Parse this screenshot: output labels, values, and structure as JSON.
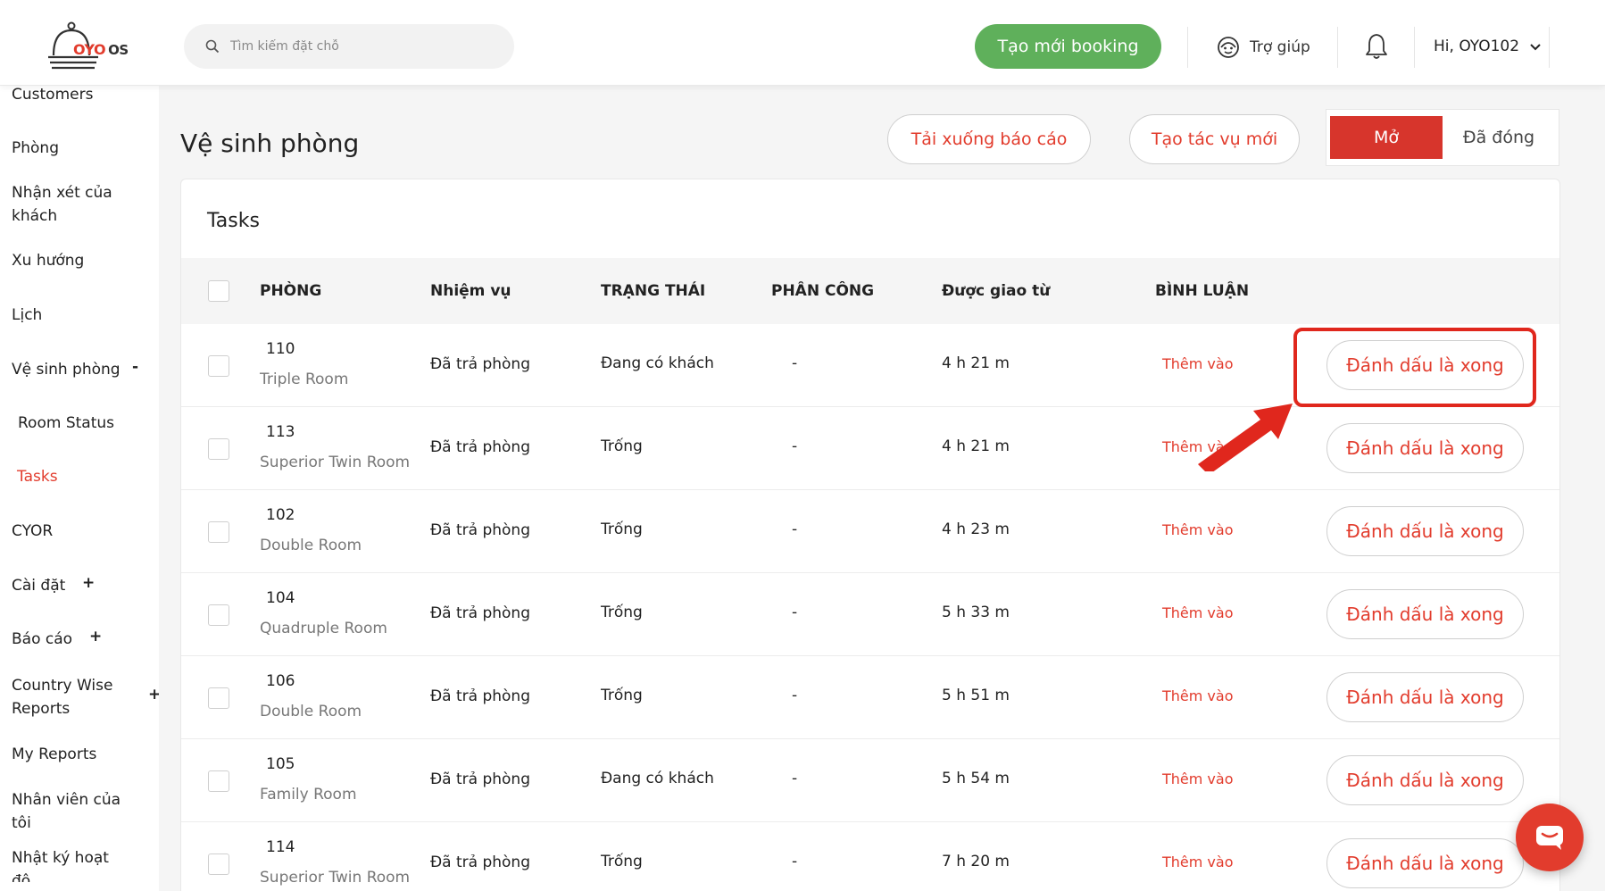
{
  "header": {
    "logo_text": "OYO",
    "logo_suffix": "OS",
    "search_placeholder": "Tìm kiếm đặt chỗ",
    "new_booking_label": "Tạo mới booking",
    "help_label": "Trợ giúp",
    "user_label": "Hi, OYO102"
  },
  "sidebar": {
    "items": [
      {
        "label": "Customers"
      },
      {
        "label": "Phòng"
      },
      {
        "label": "Nhận xét của"
      },
      {
        "label": "khách"
      },
      {
        "label": "Xu hướng"
      },
      {
        "label": "Lịch"
      },
      {
        "label": "Vệ sinh phòng",
        "sign": "-"
      },
      {
        "label": "Room Status"
      },
      {
        "label": "Tasks"
      },
      {
        "label": "CYOR"
      },
      {
        "label": "Cài đặt",
        "sign": "+"
      },
      {
        "label": "Báo cáo",
        "sign": "+"
      },
      {
        "label": "Country Wise"
      },
      {
        "label": "Reports",
        "sign": "+"
      },
      {
        "label": "My Reports"
      },
      {
        "label": "Nhân viên của"
      },
      {
        "label": "tôi"
      },
      {
        "label": "Nhật ký hoạt"
      },
      {
        "label": "đô"
      }
    ]
  },
  "page": {
    "title": "Vệ sinh phòng",
    "download_report_label": "Tải xuống báo cáo",
    "create_task_label": "Tạo tác vụ mới",
    "toggle_open_label": "Mở",
    "toggle_closed_label": "Đã đóng"
  },
  "table": {
    "card_title": "Tasks",
    "headers": [
      "PHÒNG",
      "Nhiệm vụ",
      "TRẠNG THÁI",
      "PHÂN CÔNG",
      "Được giao từ",
      "BÌNH LUẬN"
    ],
    "rows": [
      {
        "room": "110",
        "type": "Triple Room",
        "task": "Đã trả phòng",
        "status": "Đang có khách",
        "assign": "-",
        "since": "4 h 21 m",
        "comment": "Thêm vào",
        "action": "Đánh dấu là xong"
      },
      {
        "room": "113",
        "type": "Superior Twin Room",
        "task": "Đã trả phòng",
        "status": "Trống",
        "assign": "-",
        "since": "4 h 21 m",
        "comment": "Thêm vào",
        "action": "Đánh dấu là xong"
      },
      {
        "room": "102",
        "type": "Double Room",
        "task": "Đã trả phòng",
        "status": "Trống",
        "assign": "-",
        "since": "4 h 23 m",
        "comment": "Thêm vào",
        "action": "Đánh dấu là xong"
      },
      {
        "room": "104",
        "type": "Quadruple Room",
        "task": "Đã trả phòng",
        "status": "Trống",
        "assign": "-",
        "since": "5 h 33 m",
        "comment": "Thêm vào",
        "action": "Đánh dấu là xong"
      },
      {
        "room": "106",
        "type": "Double Room",
        "task": "Đã trả phòng",
        "status": "Trống",
        "assign": "-",
        "since": "5 h 51 m",
        "comment": "Thêm vào",
        "action": "Đánh dấu là xong"
      },
      {
        "room": "105",
        "type": "Family Room",
        "task": "Đã trả phòng",
        "status": "Đang có khách",
        "assign": "-",
        "since": "5 h 54 m",
        "comment": "Thêm vào",
        "action": "Đánh dấu là xong"
      },
      {
        "room": "114",
        "type": "Superior Twin Room",
        "task": "Đã trả phòng",
        "status": "Trống",
        "assign": "-",
        "since": "7 h 20 m",
        "comment": "Thêm vào",
        "action": "Đánh dấu là xong"
      }
    ]
  },
  "colors": {
    "brand_red": "#e23c2d",
    "primary_green": "#5fb05b",
    "annotation_red": "#e0271d"
  }
}
